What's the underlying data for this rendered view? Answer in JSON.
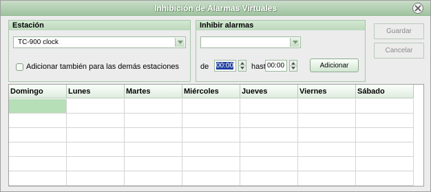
{
  "window": {
    "title": "Inhibición de Alarmas Virtuales"
  },
  "estacion": {
    "heading": "Estación",
    "selected": "TC-900 clock",
    "checkbox_label": "Adicionar también para las demás estaciones"
  },
  "inhibir": {
    "heading": "Inhibir alarmas",
    "selected": "",
    "from_label": "de",
    "from_time": "00:00",
    "to_label": "hast",
    "to_time": "00:00",
    "add_button": "Adicionar"
  },
  "actions": {
    "save": "Guardar",
    "cancel": "Cancelar"
  },
  "grid": {
    "columns": [
      "Domingo",
      "Lunes",
      "Martes",
      "Miércoles",
      "Jueves",
      "Viernes",
      "Sábado"
    ],
    "rows": 6
  }
}
